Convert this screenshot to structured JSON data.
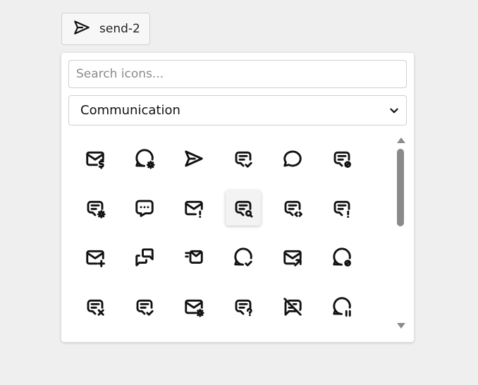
{
  "selected_icon": {
    "label": "send-2",
    "icon": "send-icon"
  },
  "search": {
    "placeholder": "Search icons...",
    "value": ""
  },
  "category": {
    "selected": "Communication"
  },
  "icons": [
    [
      "mail-dollar",
      "message-circle-cog",
      "send-2",
      "message-check",
      "message-circle",
      "message-cancel"
    ],
    [
      "message-cog",
      "message-dots",
      "mail-exclamation",
      "message-search",
      "message-code",
      "message-exclamation"
    ],
    [
      "mail-plus",
      "messages",
      "mail-fast",
      "message-circle-check",
      "mail-forward",
      "message-circle-cancel"
    ],
    [
      "message-x",
      "message-check-2",
      "mail-cog",
      "message-question",
      "message-off",
      "message-circle-pause"
    ]
  ],
  "hovered_icon": "message-search",
  "colors": {
    "icon_stroke": "#111111",
    "panel_bg": "#ffffff",
    "page_bg": "#efefef",
    "scrollbar": "#8a8a8a"
  }
}
